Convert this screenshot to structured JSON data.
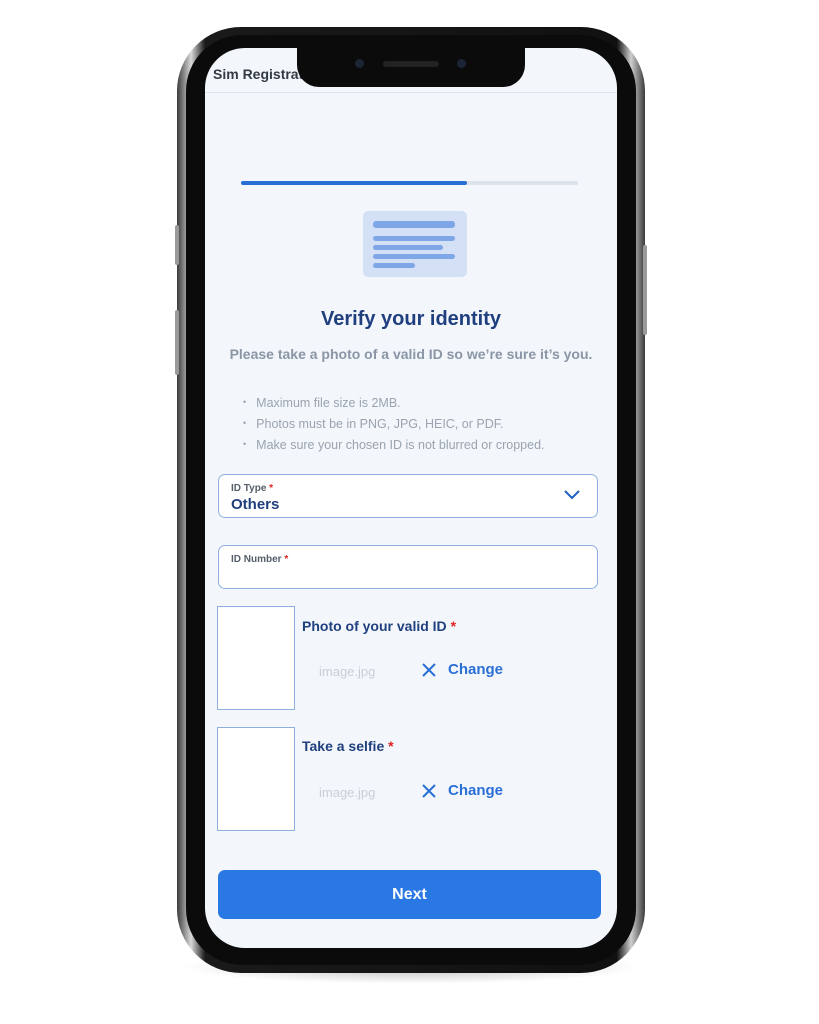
{
  "app": {
    "title": "Sim Registrat"
  },
  "progress": {
    "percent": 67,
    "color": "#2a6fd6"
  },
  "header": {
    "title": "Verify your identity",
    "subtitle": "Please take a photo of a valid ID so we’re sure it’s you."
  },
  "rules": [
    "Maximum file size is 2MB.",
    "Photos must be in PNG, JPG, HEIC, or PDF.",
    "Make sure your chosen ID is not blurred or cropped."
  ],
  "form": {
    "id_type": {
      "label": "ID Type",
      "required": "*",
      "value": "Others"
    },
    "id_number": {
      "label": "ID Number",
      "required": "*",
      "value": ""
    },
    "uploads": [
      {
        "title": "Photo of your valid ID",
        "required": "*",
        "filename": "image.jpg",
        "action": "Change"
      },
      {
        "title": "Take a selfie",
        "required": "*",
        "filename": "image.jpg",
        "action": "Change"
      }
    ]
  },
  "next_label": "Next",
  "icons": {
    "id_card": "id-card-icon",
    "chevron": "chevron-down-icon",
    "remove": "close-icon"
  }
}
